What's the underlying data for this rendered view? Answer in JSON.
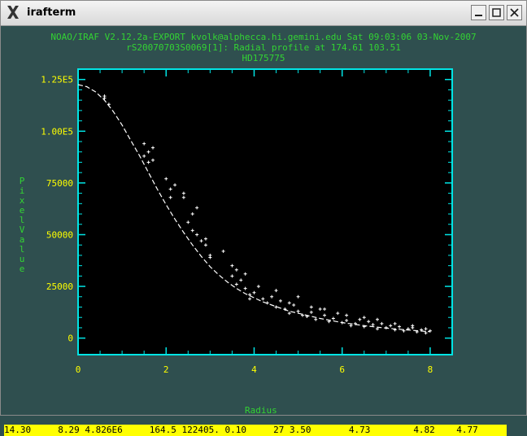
{
  "window": {
    "title": "irafterm"
  },
  "header": {
    "line1": "NOAO/IRAF V2.12.2a-EXPORT kvolk@alphecca.hi.gemini.edu Sat 09:03:06 03-Nov-2007",
    "line2": "rS20070703S0069[1]: Radial profile at 174.61 103.51",
    "line3": "HD175775"
  },
  "colors": {
    "axis": "#00e5e5",
    "tick_labels": "#ffff00",
    "text": "#33d333",
    "points": "#ffffff",
    "status_bg": "#ffff00"
  },
  "chart_data": {
    "type": "scatter",
    "xlabel": "Radius",
    "ylabel": "Pixel Value",
    "xlim": [
      0,
      8.5
    ],
    "ylim": [
      -8000,
      130000
    ],
    "x_ticks": [
      0,
      2,
      4,
      6,
      8
    ],
    "x_tick_labels": [
      "0",
      "2",
      "4",
      "6",
      "8"
    ],
    "y_ticks": [
      0,
      25000,
      50000,
      75000,
      100000,
      125000
    ],
    "y_tick_labels": [
      "0",
      "25000",
      "50000",
      "75000",
      "1.00E5",
      "1.25E5"
    ],
    "series": [
      {
        "kind": "points",
        "x": [
          0.6,
          0.6,
          0.7,
          1.5,
          1.5,
          1.6,
          1.6,
          1.7,
          1.7,
          2.0,
          2.1,
          2.1,
          2.2,
          2.4,
          2.4,
          2.5,
          2.6,
          2.6,
          2.7,
          2.7,
          2.8,
          2.9,
          2.9,
          3.0,
          3.0,
          3.3,
          3.5,
          3.5,
          3.6,
          3.7,
          3.8,
          3.8,
          3.9,
          4.0,
          4.1,
          4.2,
          4.3,
          4.4,
          4.5,
          4.6,
          4.7,
          4.8,
          4.9,
          5.0,
          5.1,
          5.2,
          5.3,
          5.4,
          5.5,
          5.6,
          5.7,
          5.8,
          5.9,
          6.0,
          6.1,
          6.2,
          6.3,
          6.4,
          6.5,
          6.6,
          6.7,
          6.8,
          6.9,
          7.0,
          7.1,
          7.2,
          7.3,
          7.4,
          7.5,
          7.6,
          7.7,
          7.8,
          7.9,
          8.0,
          6.5,
          6.8,
          7.2,
          7.6,
          7.9,
          5.6,
          6.1,
          4.5,
          4.8,
          5.0,
          5.3,
          3.6,
          3.9
        ],
        "y": [
          117000,
          116000,
          113000,
          94000,
          88000,
          85000,
          90000,
          92000,
          86000,
          77000,
          72000,
          68000,
          74000,
          70000,
          68000,
          56000,
          60000,
          52000,
          50000,
          63000,
          47000,
          45000,
          48000,
          40000,
          39000,
          42000,
          35000,
          30000,
          26000,
          28000,
          24000,
          31000,
          21000,
          22000,
          25000,
          19000,
          17000,
          20000,
          15000,
          18000,
          14000,
          12000,
          16000,
          13000,
          11000,
          10500,
          12500,
          9000,
          14000,
          11000,
          8000,
          9500,
          12000,
          7500,
          8500,
          6000,
          7000,
          9000,
          5500,
          8000,
          6500,
          4500,
          7000,
          5000,
          6000,
          4000,
          5500,
          3500,
          4500,
          5000,
          3000,
          4000,
          2500,
          3500,
          10000,
          9000,
          7000,
          6000,
          4500,
          14000,
          11000,
          23000,
          17000,
          20000,
          15000,
          33000,
          19000
        ]
      },
      {
        "kind": "fit",
        "x": [
          0,
          0.2,
          0.4,
          0.6,
          0.8,
          1.0,
          1.2,
          1.4,
          1.6,
          1.8,
          2.0,
          2.2,
          2.4,
          2.6,
          2.8,
          3.0,
          3.2,
          3.4,
          3.6,
          3.8,
          4.0,
          4.2,
          4.4,
          4.6,
          4.8,
          5.0,
          5.5,
          6.0,
          6.5,
          7.0,
          7.5,
          8.0
        ],
        "y": [
          122500,
          121500,
          119000,
          115000,
          109500,
          103000,
          95500,
          88000,
          80000,
          72000,
          64500,
          57500,
          51000,
          45000,
          39500,
          34500,
          30500,
          27000,
          24000,
          21500,
          19500,
          17500,
          16000,
          14500,
          13000,
          12000,
          9500,
          7500,
          6000,
          4800,
          3900,
          3100
        ]
      }
    ]
  },
  "status_line": "14.30     8.29 4.826E6     164.5 122405. 0.10     27 3.50       4.73        4.82    4.77"
}
